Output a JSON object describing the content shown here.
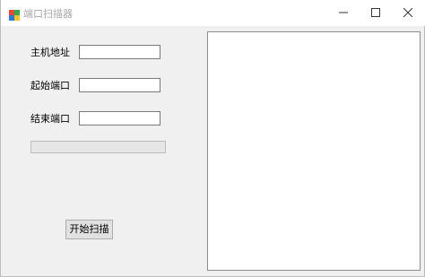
{
  "window": {
    "title": "端口扫描器",
    "minimize_label": "minimize-icon",
    "maximize_label": "maximize-icon",
    "close_label": "close-icon"
  },
  "form": {
    "host_label": "主机地址",
    "host_value": "",
    "start_port_label": "起始端口",
    "start_port_value": "",
    "end_port_label": "结束端口",
    "end_port_value": "",
    "progress_fraction": 0,
    "start_button_label": "开始扫描"
  },
  "results": {
    "text": ""
  },
  "colors": {
    "window_bg": "#f0f0f0",
    "titlebar_bg": "#ffffff",
    "title_text": "#a7a7a7",
    "button_bg": "#e1e1e1"
  }
}
